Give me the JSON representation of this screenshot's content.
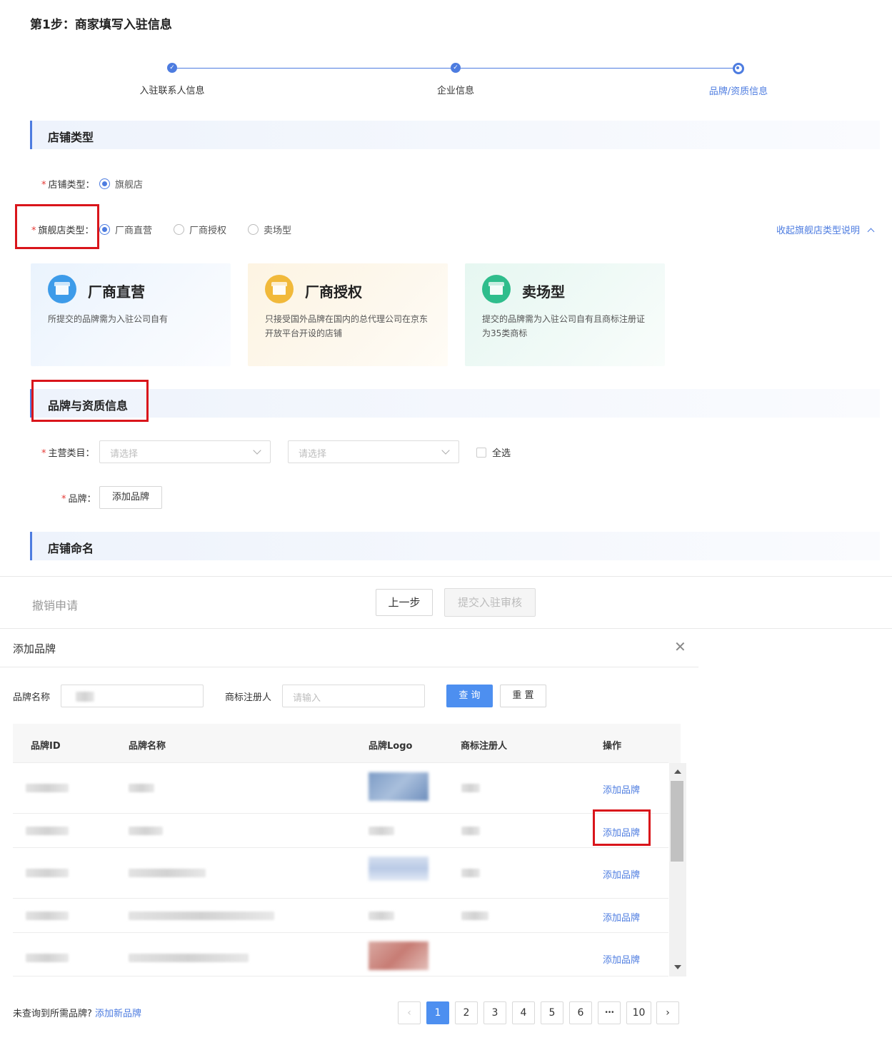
{
  "page": {
    "title": "第1步：商家填写入驻信息"
  },
  "steps": [
    {
      "label": "入驻联系人信息",
      "state": "done"
    },
    {
      "label": "企业信息",
      "state": "done"
    },
    {
      "label": "品牌/资质信息",
      "state": "current"
    }
  ],
  "store_type_section": {
    "title": "店铺类型",
    "store_type_label": "店铺类型：",
    "store_type_option": "旗舰店",
    "flagship_type_label": "旗舰店类型：",
    "flagship_options": [
      "厂商直营",
      "厂商授权",
      "卖场型"
    ],
    "selected_flagship": "厂商直营",
    "collapse_link": "收起旗舰店类型说明",
    "cards": [
      {
        "title": "厂商直营",
        "desc": "所提交的品牌需为入驻公司自有",
        "color": "#3d9be9"
      },
      {
        "title": "厂商授权",
        "desc": "只接受国外品牌在国内的总代理公司在京东开放平台开设的店铺",
        "color": "#f1b93a"
      },
      {
        "title": "卖场型",
        "desc": "提交的品牌需为入驻公司自有且商标注册证为35类商标",
        "color": "#2fbd8c"
      }
    ]
  },
  "brand_section": {
    "title": "品牌与资质信息",
    "category_label": "主营类目：",
    "select1_placeholder": "请选择",
    "select2_placeholder": "请选择",
    "select_all": "全选",
    "brand_label": "品牌：",
    "add_brand_button": "添加品牌"
  },
  "store_name_section": {
    "title": "店铺命名"
  },
  "footer": {
    "cancel": "撤销申请",
    "prev": "上一步",
    "submit": "提交入驻审核"
  },
  "modal": {
    "title": "添加品牌",
    "brand_name_label": "品牌名称",
    "registrant_label": "商标注册人",
    "registrant_placeholder": "请输入",
    "query_button": "查 询",
    "reset_button": "重 置",
    "columns": [
      "品牌ID",
      "品牌名称",
      "品牌Logo",
      "商标注册人",
      "操作"
    ],
    "row_action": "添加品牌",
    "not_found_text": "未查询到所需品牌?",
    "add_new_link": "添加新品牌"
  },
  "pagination": {
    "prev": "‹",
    "next": "›",
    "pages": [
      "1",
      "2",
      "3",
      "4",
      "5",
      "6",
      "•••",
      "10"
    ],
    "current": "1"
  },
  "colors": {
    "accent": "#4d7ce0",
    "highlight": "#d9151b",
    "primary_button": "#4d8ff0"
  }
}
